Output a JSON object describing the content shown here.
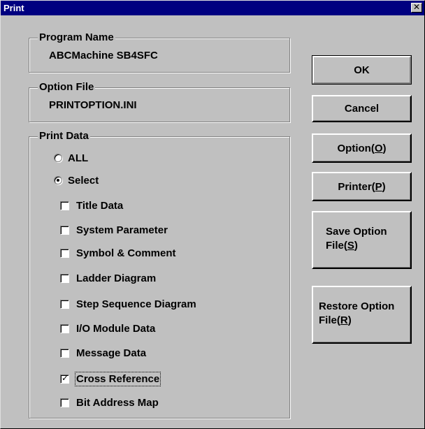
{
  "window": {
    "title": "Print",
    "close_glyph": "✕"
  },
  "program_name": {
    "label": "Program Name",
    "value": "ABCMachine SB4SFC"
  },
  "option_file": {
    "label": "Option File",
    "value": "PRINTOPTION.INI"
  },
  "print_data": {
    "label": "Print Data",
    "radios": [
      {
        "label": "ALL",
        "selected": false
      },
      {
        "label": "Select",
        "selected": true
      }
    ],
    "checkboxes": [
      {
        "label": "Title Data",
        "checked": false
      },
      {
        "label": "System Parameter",
        "checked": false
      },
      {
        "label": "Symbol & Comment",
        "checked": false
      },
      {
        "label": "Ladder Diagram",
        "checked": false
      },
      {
        "label": "Step Sequence Diagram",
        "checked": false
      },
      {
        "label": "I/O Module Data",
        "checked": false
      },
      {
        "label": "Message Data",
        "checked": false
      },
      {
        "label": "Cross Reference",
        "checked": true,
        "focused": true
      },
      {
        "label": "Bit Address Map",
        "checked": false
      }
    ]
  },
  "buttons": {
    "ok": "OK",
    "cancel": "Cancel",
    "option": {
      "text": "Option(",
      "key": "O",
      "close": ")"
    },
    "printer": {
      "text": "Printer(",
      "key": "P",
      "close": ")"
    },
    "save_option": {
      "line1": "Save Option",
      "line2": "File(",
      "key": "S",
      "close": ")"
    },
    "restore_option": {
      "line1": "Restore Option",
      "line2": "File(",
      "key": "R",
      "close": ")"
    }
  }
}
